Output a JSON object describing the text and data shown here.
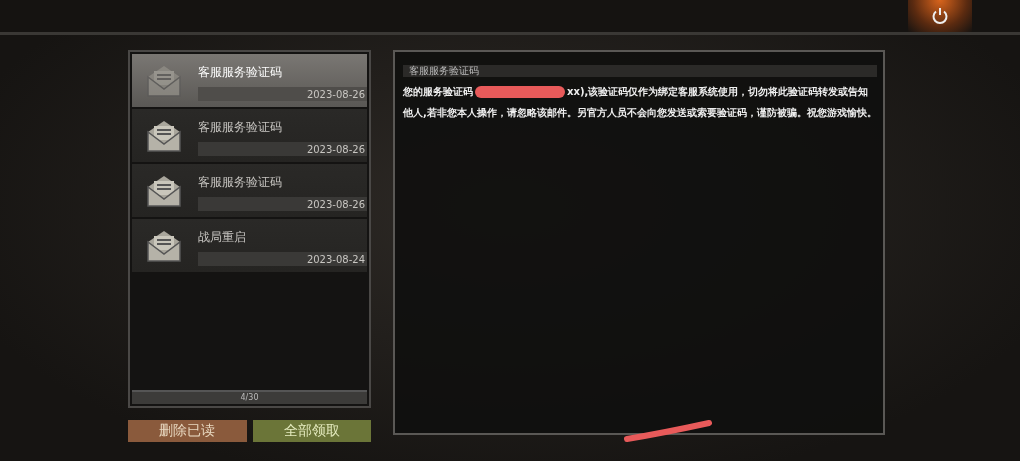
{
  "mail_list": {
    "items": [
      {
        "title": "客服服务验证码",
        "date": "2023-08-26",
        "selected": true
      },
      {
        "title": "客服服务验证码",
        "date": "2023-08-26",
        "selected": false
      },
      {
        "title": "客服服务验证码",
        "date": "2023-08-26",
        "selected": false
      },
      {
        "title": "战局重启",
        "date": "2023-08-24",
        "selected": false
      }
    ],
    "count": "4/30"
  },
  "buttons": [
    {
      "label": "删除已读",
      "kind": "delete"
    },
    {
      "label": "全部领取",
      "kind": "claim"
    }
  ],
  "mail_detail": {
    "title": "客服服务验证码",
    "body_start": "您的服务验证码",
    "body_rest": "xx),该验证码仅作为绑定客服系统使用，切勿将此验证码转发或告知他人,若非您本人操作，请忽略该邮件。另官方人员不会向您发送或索要验证码，谨防被骗。祝您游戏愉快。"
  }
}
